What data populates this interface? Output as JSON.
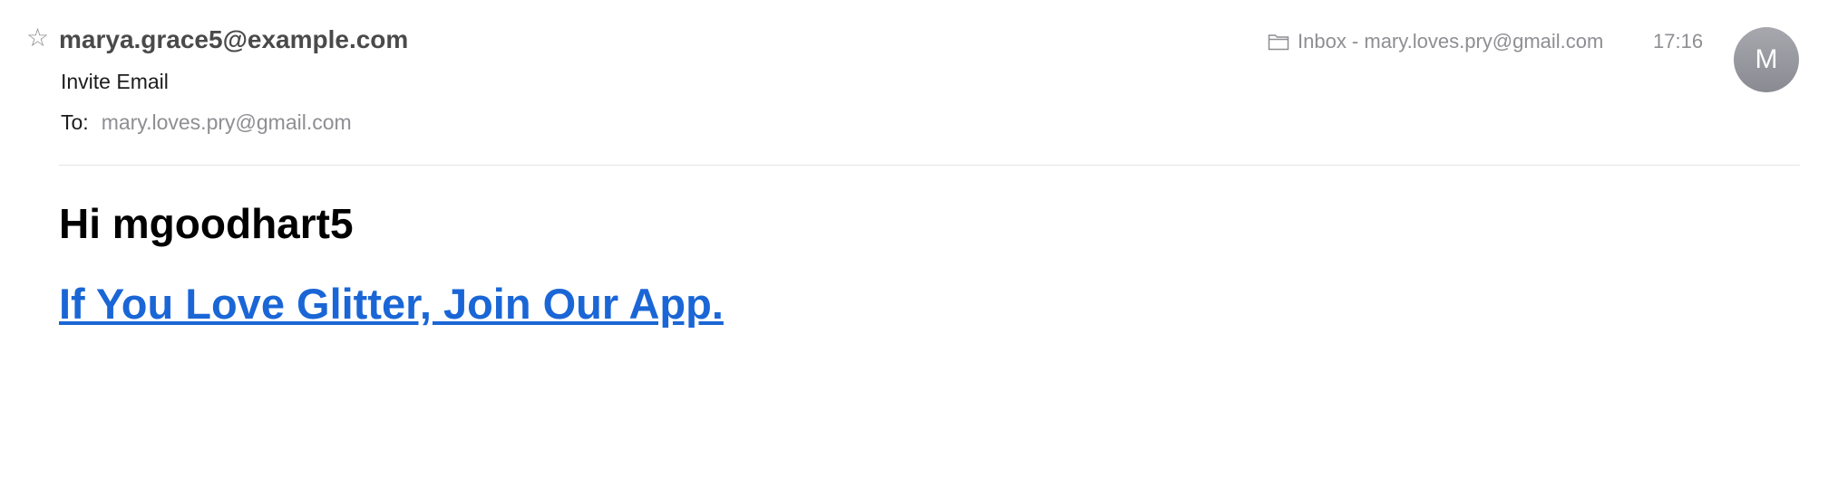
{
  "header": {
    "sender": "marya.grace5@example.com",
    "subject": "Invite Email",
    "to_label": "To:",
    "to_address": "mary.loves.pry@gmail.com",
    "mailbox": "Inbox - mary.loves.pry@gmail.com",
    "time": "17:16",
    "avatar_initial": "M",
    "star_glyph": "☆"
  },
  "icons": {
    "star": "star-icon",
    "mailbox": "folder-icon"
  },
  "body": {
    "greeting": "Hi mgoodhart5",
    "cta_link": "If You Love Glitter, Join Our App."
  },
  "colors": {
    "link": "#1a66d6",
    "secondary_text": "#8e8e93",
    "avatar": "#9a9aa1"
  }
}
